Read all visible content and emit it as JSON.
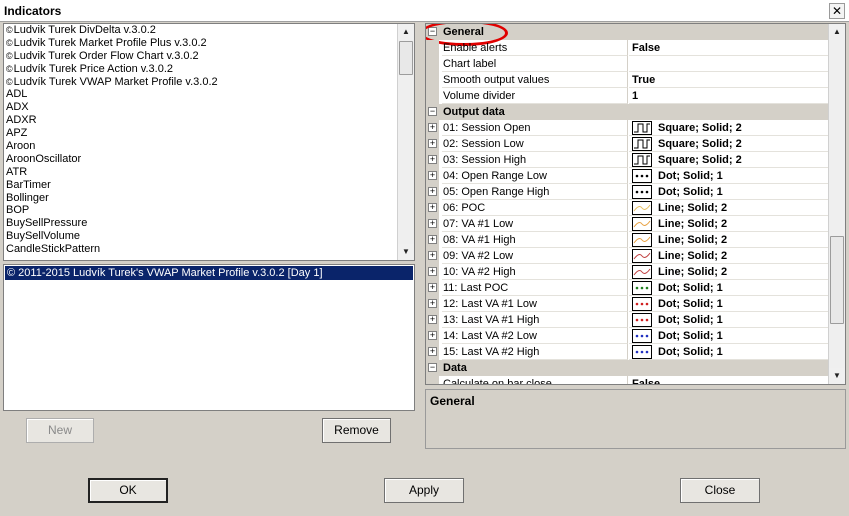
{
  "window": {
    "title": "Indicators",
    "close_glyph": "✕"
  },
  "indicator_list": {
    "items": [
      {
        "label": "Ludvik Turek DivDelta v.3.0.2",
        "ludvik": true
      },
      {
        "label": "Ludvik Turek Market Profile Plus v.3.0.2",
        "ludvik": true
      },
      {
        "label": "Ludvik Turek Order Flow Chart v.3.0.2",
        "ludvik": true
      },
      {
        "label": "Ludvík Turek Price Action v.3.0.2",
        "ludvik": true
      },
      {
        "label": "Ludvík Turek VWAP Market Profile v.3.0.2",
        "ludvik": true
      },
      {
        "label": "ADL"
      },
      {
        "label": "ADX"
      },
      {
        "label": "ADXR"
      },
      {
        "label": "APZ"
      },
      {
        "label": "Aroon"
      },
      {
        "label": "AroonOscillator"
      },
      {
        "label": "ATR"
      },
      {
        "label": "BarTimer"
      },
      {
        "label": "Bollinger"
      },
      {
        "label": "BOP"
      },
      {
        "label": "BuySellPressure"
      },
      {
        "label": "BuySellVolume"
      },
      {
        "label": "CandleStickPattern"
      }
    ],
    "copyright_glyph": "©"
  },
  "applied_list": {
    "selected": "© 2011-2015 Ludvík Turek's VWAP Market Profile v.3.0.2 [Day 1]"
  },
  "buttons": {
    "new": "New",
    "remove": "Remove",
    "ok": "OK",
    "apply": "Apply",
    "close": "Close"
  },
  "property_grid": {
    "categories": {
      "general": "General",
      "output_data": "Output data",
      "data": "Data"
    },
    "general": [
      {
        "name": "Enable alerts",
        "value": "False"
      },
      {
        "name": "Chart label",
        "value": ""
      },
      {
        "name": "Smooth output values",
        "value": "True"
      },
      {
        "name": "Volume divider",
        "value": "1"
      }
    ],
    "outputs": [
      {
        "name": "01: Session Open",
        "value": "Square; Solid; 2",
        "icon": "square-plot-icon",
        "color": "#000000"
      },
      {
        "name": "02: Session Low",
        "value": "Square; Solid; 2",
        "icon": "square-plot-icon",
        "color": "#000000"
      },
      {
        "name": "03: Session High",
        "value": "Square; Solid; 2",
        "icon": "square-plot-icon",
        "color": "#000000"
      },
      {
        "name": "04: Open Range Low",
        "value": "Dot; Solid; 1",
        "icon": "dot-plot-icon",
        "color": "#000000"
      },
      {
        "name": "05: Open Range High",
        "value": "Dot; Solid; 1",
        "icon": "dot-plot-icon",
        "color": "#000000"
      },
      {
        "name": "06: POC",
        "value": "Line; Solid; 2",
        "icon": "line-plot-icon",
        "color": "#e8c060"
      },
      {
        "name": "07: VA #1 Low",
        "value": "Line; Solid; 2",
        "icon": "line-plot-icon",
        "color": "#e8a040"
      },
      {
        "name": "08: VA #1 High",
        "value": "Line; Solid; 2",
        "icon": "line-plot-icon",
        "color": "#e8a040"
      },
      {
        "name": "09: VA #2 Low",
        "value": "Line; Solid; 2",
        "icon": "line-plot-icon",
        "color": "#c04040"
      },
      {
        "name": "10: VA #2 High",
        "value": "Line; Solid; 2",
        "icon": "line-plot-icon",
        "color": "#c04040"
      },
      {
        "name": "11: Last POC",
        "value": "Dot; Solid; 1",
        "icon": "dot-plot-icon",
        "color": "#208020"
      },
      {
        "name": "12: Last VA #1 Low",
        "value": "Dot; Solid; 1",
        "icon": "dot-plot-icon",
        "color": "#d02020"
      },
      {
        "name": "13: Last VA #1 High",
        "value": "Dot; Solid; 1",
        "icon": "dot-plot-icon",
        "color": "#d02020"
      },
      {
        "name": "14: Last VA #2 Low",
        "value": "Dot; Solid; 1",
        "icon": "dot-plot-icon",
        "color": "#2030c0"
      },
      {
        "name": "15: Last VA #2 High",
        "value": "Dot; Solid; 1",
        "icon": "dot-plot-icon",
        "color": "#2030c0"
      }
    ],
    "data": [
      {
        "name": "Calculate on bar close",
        "value": "False"
      }
    ]
  },
  "description": {
    "title": "General"
  },
  "highlight": {
    "color": "#e00000"
  }
}
